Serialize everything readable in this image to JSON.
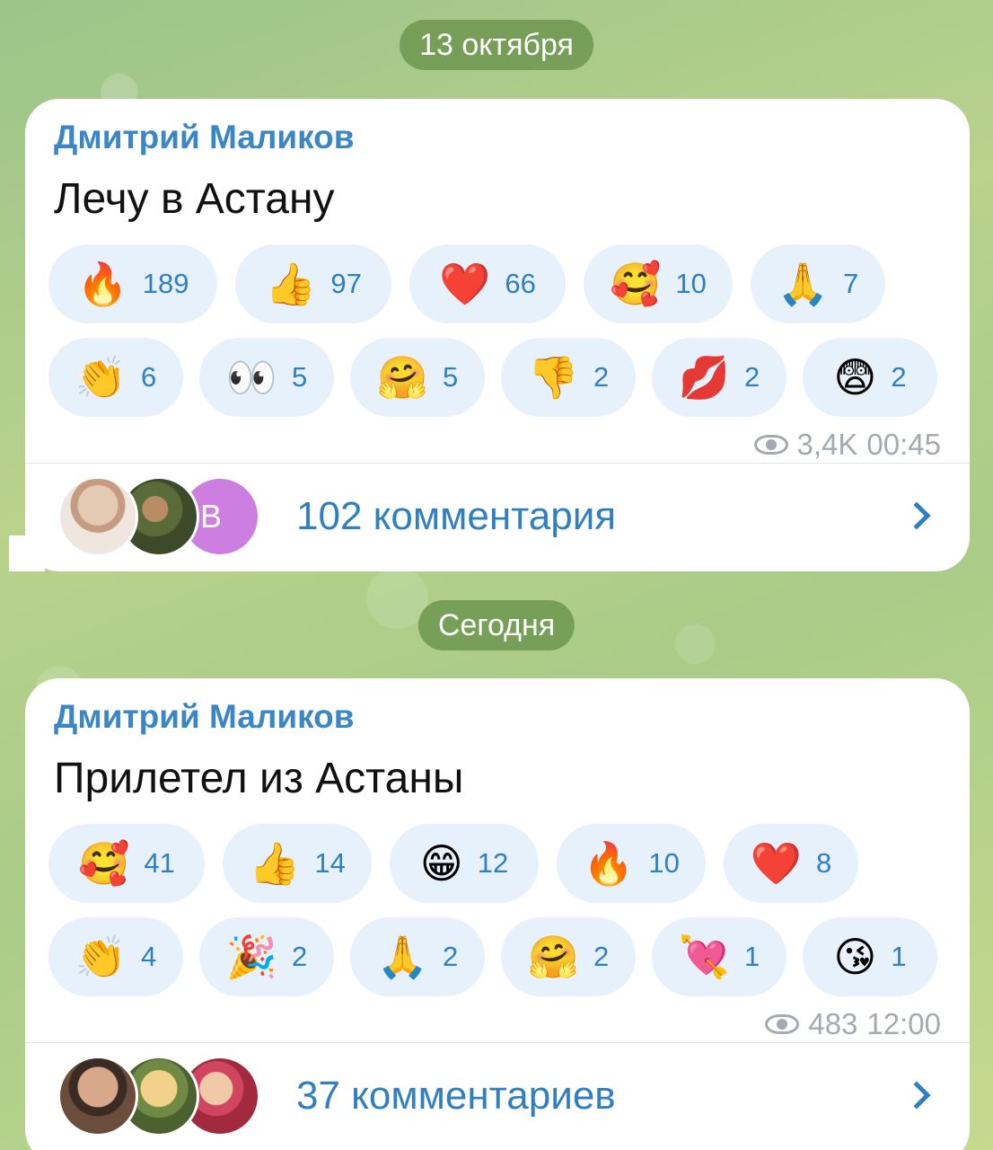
{
  "dates": {
    "first": "13 октября",
    "second": "Сегодня"
  },
  "posts": [
    {
      "author": "Дмитрий Маликов",
      "text": "Лечу в Астану",
      "reactions_row1": [
        {
          "emoji": "🔥",
          "count": "189"
        },
        {
          "emoji": "👍",
          "count": "97"
        },
        {
          "emoji": "❤️",
          "count": "66"
        },
        {
          "emoji": "🥰",
          "count": "10"
        },
        {
          "emoji": "🙏",
          "count": "7"
        }
      ],
      "reactions_row2": [
        {
          "emoji": "👏",
          "count": "6"
        },
        {
          "emoji": "👀",
          "count": "5"
        },
        {
          "emoji": "🤗",
          "count": "5"
        },
        {
          "emoji": "👎",
          "count": "2"
        },
        {
          "emoji": "💋",
          "count": "2"
        },
        {
          "emoji": "😨",
          "count": "2"
        }
      ],
      "views": "3,4K",
      "time": "00:45",
      "avatar_letter": "В",
      "comments": "102 комментария"
    },
    {
      "author": "Дмитрий Маликов",
      "text": "Прилетел из Астаны",
      "reactions_row1": [
        {
          "emoji": "🥰",
          "count": "41"
        },
        {
          "emoji": "👍",
          "count": "14"
        },
        {
          "emoji": "😁",
          "count": "12"
        },
        {
          "emoji": "🔥",
          "count": "10"
        },
        {
          "emoji": "❤️",
          "count": "8"
        }
      ],
      "reactions_row2": [
        {
          "emoji": "👏",
          "count": "4"
        },
        {
          "emoji": "🎉",
          "count": "2"
        },
        {
          "emoji": "🙏",
          "count": "2"
        },
        {
          "emoji": "🤗",
          "count": "2"
        },
        {
          "emoji": "💘",
          "count": "1"
        },
        {
          "emoji": "😘",
          "count": "1"
        }
      ],
      "views": "483",
      "time": "12:00",
      "comments": "37 комментариев"
    }
  ]
}
